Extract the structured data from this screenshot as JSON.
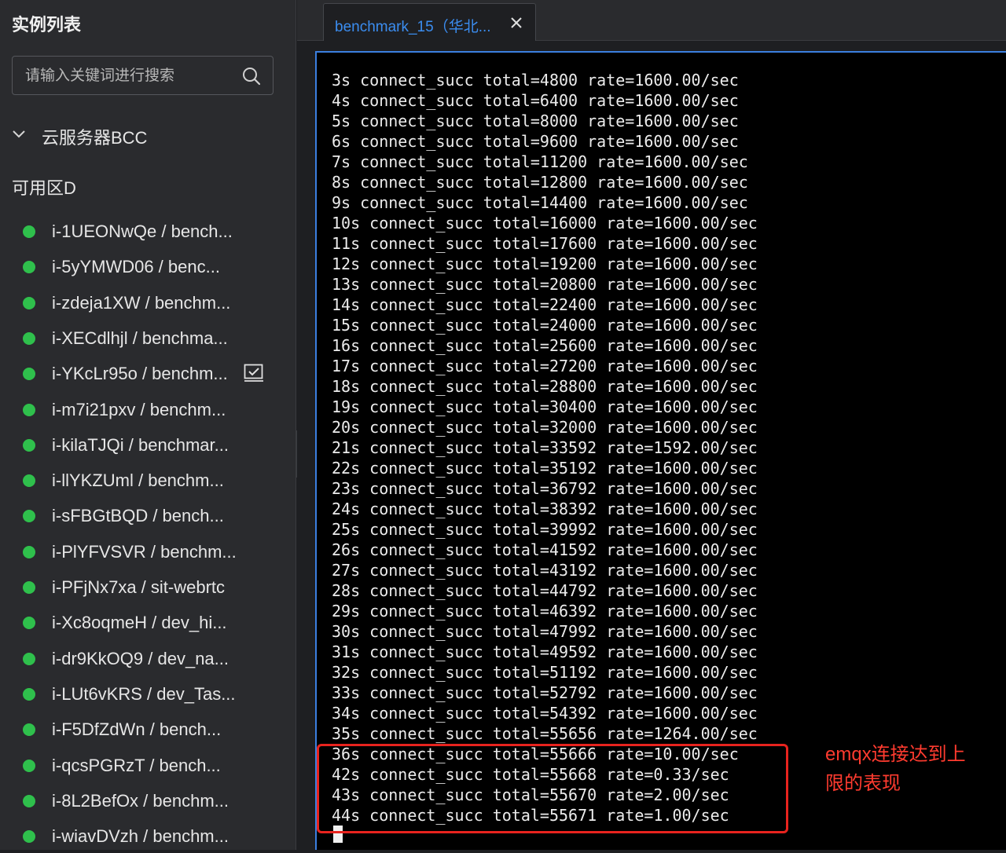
{
  "sidebar": {
    "title": "实例列表",
    "search": {
      "placeholder": "请输入关键词进行搜索"
    },
    "group": {
      "label": "云服务器BCC",
      "expanded": true
    },
    "zone": "可用区D",
    "status_color": "#2fc04c",
    "instances": [
      {
        "label": "i-1UEONwQe / bench..."
      },
      {
        "label": "i-5yYMWD06 / benc..."
      },
      {
        "label": "i-zdeja1XW / benchm..."
      },
      {
        "label": "i-XECdlhjl / benchma..."
      },
      {
        "label": "i-YKcLr95o / benchm...",
        "checked": true
      },
      {
        "label": "i-m7i21pxv / benchm..."
      },
      {
        "label": "i-kilaTJQi / benchmar..."
      },
      {
        "label": "i-llYKZUml / benchm..."
      },
      {
        "label": "i-sFBGtBQD / bench..."
      },
      {
        "label": "i-PlYFVSVR / benchm..."
      },
      {
        "label": "i-PFjNx7xa / sit-webrtc"
      },
      {
        "label": "i-Xc8oqmeH / dev_hi..."
      },
      {
        "label": "i-dr9KkOQ9 / dev_na..."
      },
      {
        "label": "i-LUt6vKRS / dev_Tas..."
      },
      {
        "label": "i-F5DfZdWn / bench..."
      },
      {
        "label": "i-qcsPGRzT / bench..."
      },
      {
        "label": "i-8L2BefOx / benchm..."
      },
      {
        "label": "i-wiavDVzh / benchm..."
      }
    ]
  },
  "tab": {
    "label": "benchmark_15（华北...",
    "active_color": "#3b8df0"
  },
  "terminal": {
    "lines": [
      "3s connect_succ total=4800 rate=1600.00/sec",
      "4s connect_succ total=6400 rate=1600.00/sec",
      "5s connect_succ total=8000 rate=1600.00/sec",
      "6s connect_succ total=9600 rate=1600.00/sec",
      "7s connect_succ total=11200 rate=1600.00/sec",
      "8s connect_succ total=12800 rate=1600.00/sec",
      "9s connect_succ total=14400 rate=1600.00/sec",
      "10s connect_succ total=16000 rate=1600.00/sec",
      "11s connect_succ total=17600 rate=1600.00/sec",
      "12s connect_succ total=19200 rate=1600.00/sec",
      "13s connect_succ total=20800 rate=1600.00/sec",
      "14s connect_succ total=22400 rate=1600.00/sec",
      "15s connect_succ total=24000 rate=1600.00/sec",
      "16s connect_succ total=25600 rate=1600.00/sec",
      "17s connect_succ total=27200 rate=1600.00/sec",
      "18s connect_succ total=28800 rate=1600.00/sec",
      "19s connect_succ total=30400 rate=1600.00/sec",
      "20s connect_succ total=32000 rate=1600.00/sec",
      "21s connect_succ total=33592 rate=1592.00/sec",
      "22s connect_succ total=35192 rate=1600.00/sec",
      "23s connect_succ total=36792 rate=1600.00/sec",
      "24s connect_succ total=38392 rate=1600.00/sec",
      "25s connect_succ total=39992 rate=1600.00/sec",
      "26s connect_succ total=41592 rate=1600.00/sec",
      "27s connect_succ total=43192 rate=1600.00/sec",
      "28s connect_succ total=44792 rate=1600.00/sec",
      "29s connect_succ total=46392 rate=1600.00/sec",
      "30s connect_succ total=47992 rate=1600.00/sec",
      "31s connect_succ total=49592 rate=1600.00/sec",
      "32s connect_succ total=51192 rate=1600.00/sec",
      "33s connect_succ total=52792 rate=1600.00/sec",
      "34s connect_succ total=54392 rate=1600.00/sec",
      "35s connect_succ total=55656 rate=1264.00/sec",
      "36s connect_succ total=55666 rate=10.00/sec",
      "42s connect_succ total=55668 rate=0.33/sec",
      "43s connect_succ total=55670 rate=2.00/sec",
      "44s connect_succ total=55671 rate=1.00/sec"
    ],
    "annotation": "emqx连接达到上限的表现",
    "annotation_color": "#ff3b2f"
  }
}
